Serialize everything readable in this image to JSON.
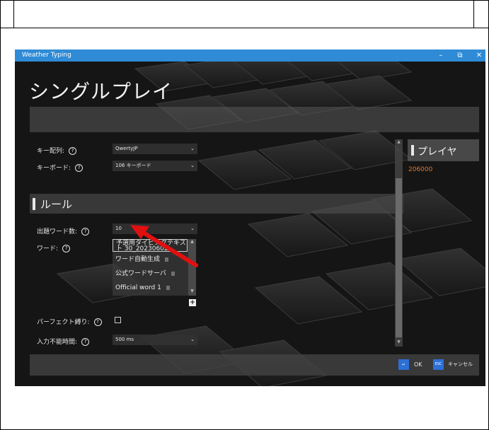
{
  "window": {
    "title": "Weather Typing",
    "minimize": "–",
    "restore": "⧉",
    "close": "✕"
  },
  "page": {
    "heading": "シングルプレイ"
  },
  "settings": {
    "key_layout_label": "キー配列:",
    "key_layout_value": "QwertyJP",
    "keyboard_label": "キーボード:",
    "keyboard_value": "106 キーボード"
  },
  "rules": {
    "section_title": "ルール",
    "word_count_label": "出題ワード数:",
    "word_count_value": "10",
    "words_label": "ワード:",
    "word_items": [
      {
        "label": "予選用タイピングテキスト 30_20230602..."
      },
      {
        "label": "ワード自動生成"
      },
      {
        "label": "公式ワードサーバ"
      },
      {
        "label": "Official word 1"
      }
    ],
    "add_symbol": "+",
    "perfect_label": "パーフェクト縛り:",
    "perfect_checked": false,
    "disable_time_label": "入力不能時間:",
    "disable_time_value": "500 ms"
  },
  "help_symbol": "?",
  "dropdown_symbol": "⌄",
  "player": {
    "title": "プレイヤ",
    "score": "206000"
  },
  "footer": {
    "ok_key": "↵",
    "ok_label": "OK",
    "cancel_key": "ESC",
    "cancel_label": "キャンセル"
  },
  "colors": {
    "titlebar": "#2f8bd6",
    "accent_key": "#2c6fd6",
    "score": "#e07830",
    "annotation_arrow": "#e01010"
  }
}
